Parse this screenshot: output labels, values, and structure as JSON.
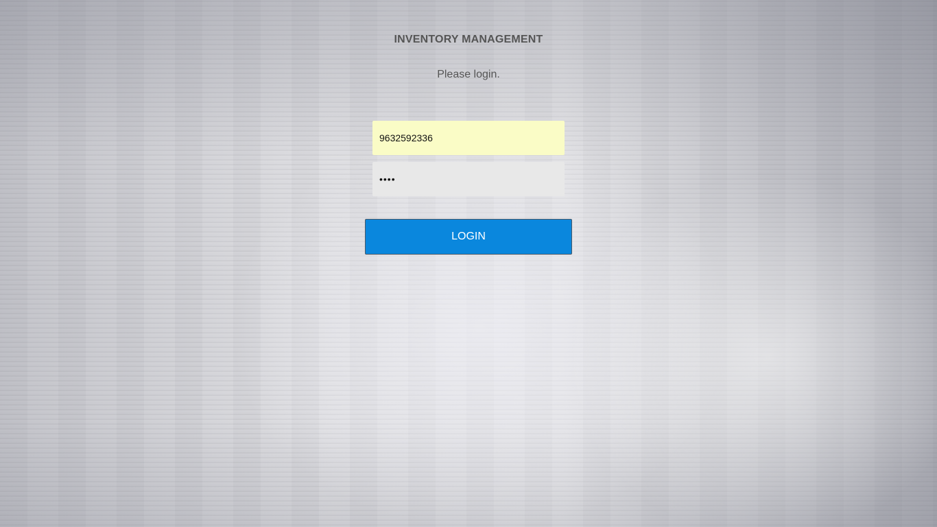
{
  "header": {
    "title": "INVENTORY MANAGEMENT",
    "subtitle": "Please login."
  },
  "form": {
    "username": {
      "value": "9632592336"
    },
    "password": {
      "value": "1234"
    },
    "login_label": "LOGIN"
  },
  "colors": {
    "button": "#0a87dd",
    "username_bg": "#fafcc6",
    "password_bg": "#e8e8e8",
    "text": "#555555"
  }
}
